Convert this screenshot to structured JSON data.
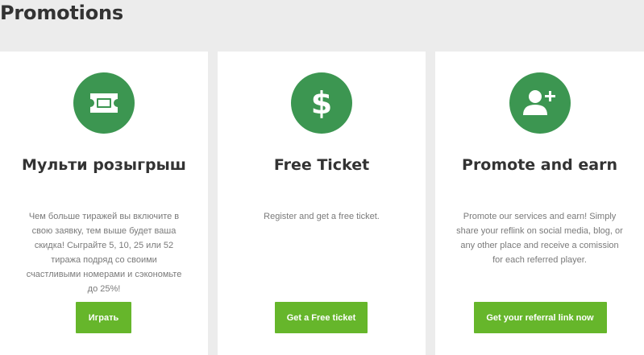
{
  "page": {
    "title": "Promotions"
  },
  "colors": {
    "accent_green": "#3c9651",
    "button_green": "#66b62b",
    "background": "#ececec"
  },
  "cards": [
    {
      "icon": "ticket-icon",
      "title": "Мульти розыгрыш",
      "description": "Чем больше тиражей вы включите в свою заявку, тем выше будет ваша скидка! Сыграйте 5, 10, 25 или 52 тиража подряд со своими счастливыми номерами и сэкономьте до 25%!",
      "button_label": "Играть"
    },
    {
      "icon": "dollar-icon",
      "title": "Free Ticket",
      "description": "Register and get a free ticket.",
      "button_label": "Get a Free ticket"
    },
    {
      "icon": "add-user-icon",
      "title": "Promote and earn",
      "description": "Promote our services and earn! Simply share your reflink on social media, blog, or any other place and receive a comission for each referred player.",
      "button_label": "Get your referral link now"
    }
  ]
}
